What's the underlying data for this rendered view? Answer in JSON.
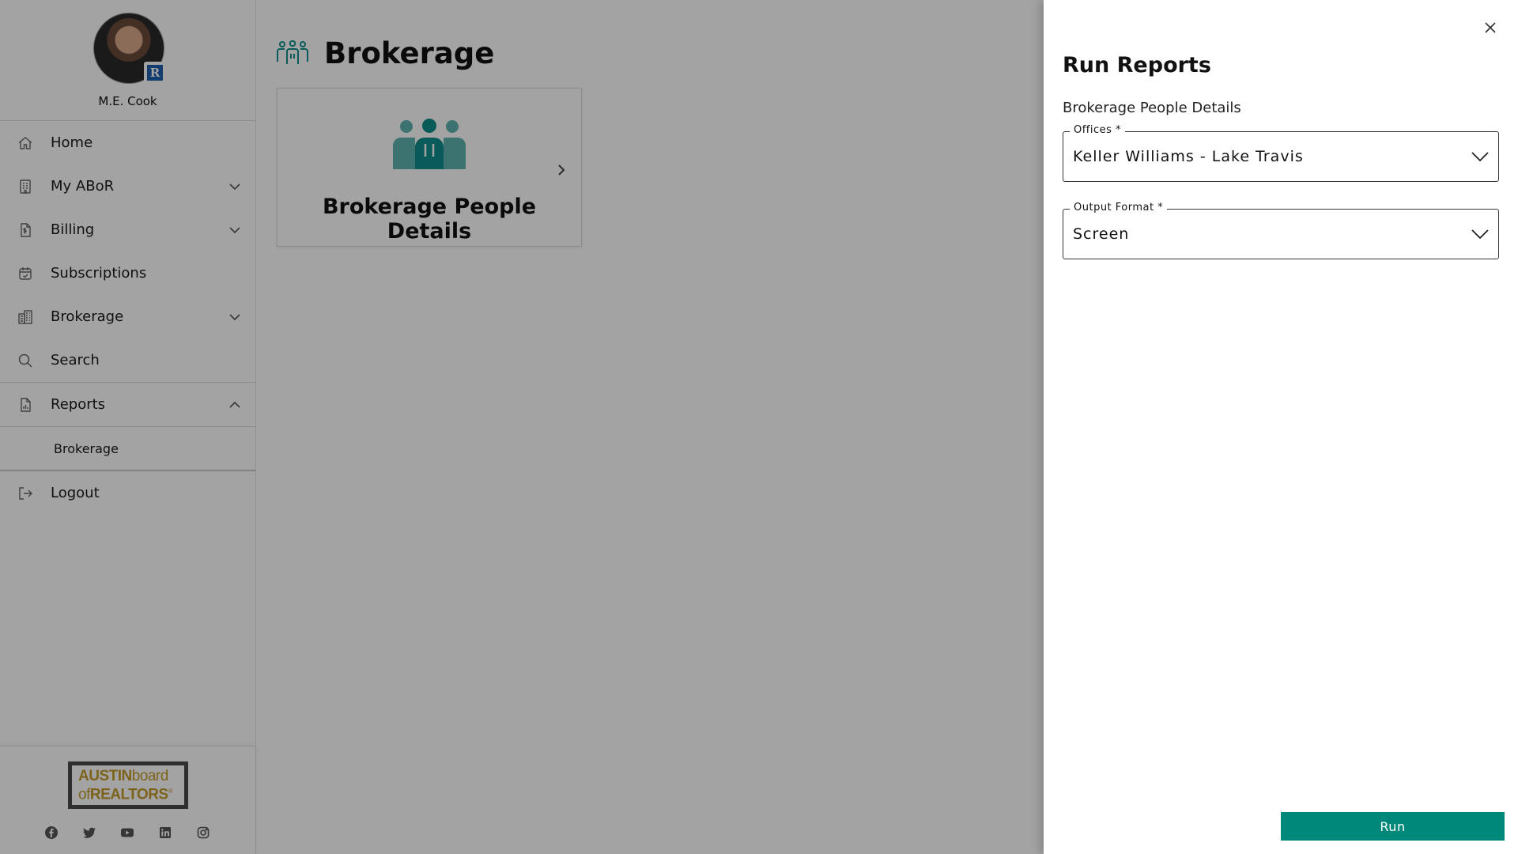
{
  "user": {
    "name": "M.E. Cook",
    "badge_letter": "R"
  },
  "sidebar": {
    "items": [
      {
        "label": "Home",
        "icon": "home-icon",
        "expandable": false
      },
      {
        "label": "My ABoR",
        "icon": "building-icon",
        "expandable": true
      },
      {
        "label": "Billing",
        "icon": "invoice-icon",
        "expandable": true
      },
      {
        "label": "Subscriptions",
        "icon": "calendar-check-icon",
        "expandable": false
      },
      {
        "label": "Brokerage",
        "icon": "office-buildings-icon",
        "expandable": true
      },
      {
        "label": "Search",
        "icon": "search-icon",
        "expandable": false
      }
    ],
    "reports": {
      "label": "Reports",
      "icon": "report-icon",
      "expanded": true,
      "sub_items": [
        "Brokerage"
      ]
    },
    "logout": {
      "label": "Logout",
      "icon": "logout-icon"
    },
    "footer": {
      "logo_line1_bold": "AUSTIN",
      "logo_line1_thin": "board",
      "logo_line2_thin": "of",
      "logo_line2_bold": "REALTORS",
      "logo_mark": "®",
      "social": [
        "facebook-icon",
        "twitter-icon",
        "youtube-icon",
        "linkedin-icon",
        "instagram-icon"
      ]
    }
  },
  "main": {
    "page_title": "Brokerage",
    "cards": [
      {
        "title": "Brokerage People Details",
        "icon": "people-group-icon"
      }
    ]
  },
  "drawer": {
    "title": "Run Reports",
    "subtitle": "Brokerage People Details",
    "fields": [
      {
        "label": "Offices *",
        "value": "Keller Williams - Lake Travis"
      },
      {
        "label": "Output Format *",
        "value": "Screen"
      }
    ],
    "run_label": "Run"
  },
  "colors": {
    "accent": "#00897b",
    "icon_teal": "#0e8f8a",
    "logo_gold": "#c49a2c",
    "logo_border": "#4a4a4a",
    "overlay": "rgba(0,0,0,0.36)"
  }
}
